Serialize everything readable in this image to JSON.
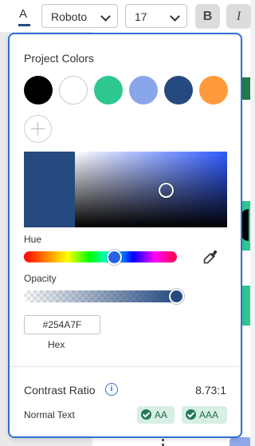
{
  "toolbar": {
    "text_color_glyph": "A",
    "text_color_value": "#254A7F",
    "font_family": "Roboto",
    "font_size": "17",
    "bold_label": "B",
    "italic_label": "I"
  },
  "picker": {
    "section_title": "Project Colors",
    "swatches": [
      {
        "name": "black",
        "color": "#000000"
      },
      {
        "name": "white",
        "color": "#ffffff"
      },
      {
        "name": "green",
        "color": "#2ec790"
      },
      {
        "name": "periwinkle",
        "color": "#8aa6ea"
      },
      {
        "name": "navy",
        "color": "#254A7F"
      },
      {
        "name": "orange",
        "color": "#ff9a3c"
      }
    ],
    "add_icon": "plus-icon",
    "hue_label": "Hue",
    "opacity_label": "Opacity",
    "hex_value": "#254A7F",
    "hex_label": "Hex",
    "eyedropper_icon": "eyedropper-icon",
    "hue_level": 0.61,
    "opacity_level": 1.0
  },
  "contrast": {
    "title": "Contrast Ratio",
    "info_glyph": "i",
    "ratio": "8.73:1",
    "normal_text_label": "Normal Text",
    "badge_aa": "AA",
    "badge_aaa": "AAA"
  },
  "colors": {
    "accent": "#2f6fd6",
    "selected": "#254A7F",
    "pass_badge_bg": "#d7efe4",
    "pass_badge_fg": "#1f6b4c"
  }
}
